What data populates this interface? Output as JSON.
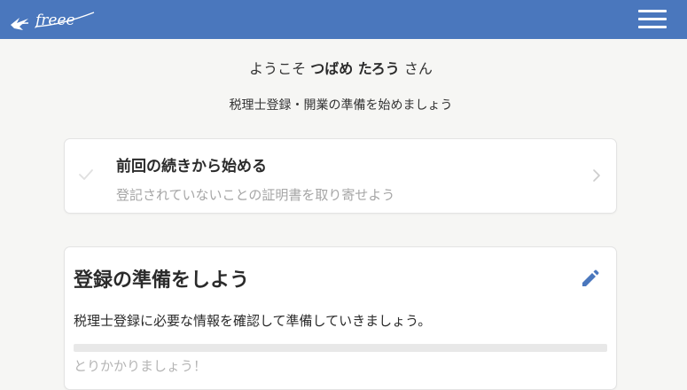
{
  "header": {
    "logo_text": "freee",
    "logo_icon": "swallow-logo",
    "menu_icon": "hamburger-menu-icon",
    "background_color": "#4a77bd"
  },
  "welcome": {
    "prefix": "ようこそ ",
    "user_name": "つばめ たろう",
    "suffix": " さん"
  },
  "subtitle": "税理士登録・開業の準備を始めましょう",
  "resume_card": {
    "title": "前回の続きから始める",
    "next_step": "登記されていないことの証明書を取り寄せよう",
    "check_icon": "checkmark-icon",
    "chevron_icon": "chevron-right-icon"
  },
  "prep_card": {
    "title": "登録の準備をしよう",
    "edit_icon": "pencil-icon",
    "description": "税理士登録に必要な情報を確認して準備していきましょう。",
    "progress_fraction": 0,
    "progress_label": "とりかかりましょう！"
  }
}
